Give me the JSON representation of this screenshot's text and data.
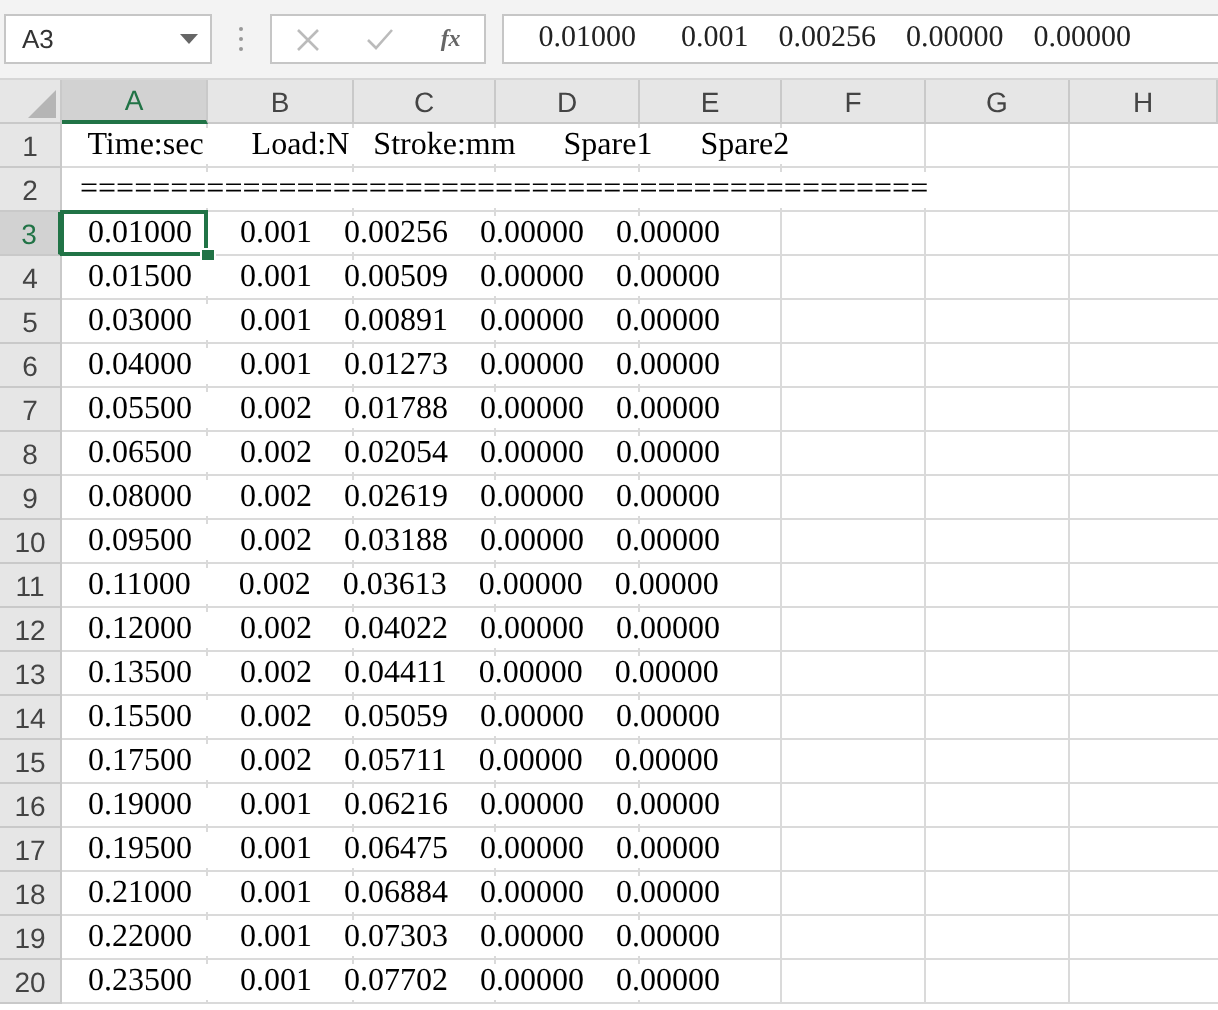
{
  "name_box": "A3",
  "formula_bar": {
    "fx_label": "fx",
    "value": "   0.01000      0.001    0.00256    0.00000    0.00000"
  },
  "columns": [
    {
      "label": "A",
      "selected": true
    },
    {
      "label": "B",
      "selected": false
    },
    {
      "label": "C",
      "selected": false
    },
    {
      "label": "D",
      "selected": false
    },
    {
      "label": "E",
      "selected": false
    },
    {
      "label": "F",
      "selected": false
    },
    {
      "label": "G",
      "selected": false
    },
    {
      "label": "H",
      "selected": false
    }
  ],
  "rows": [
    {
      "number": "1",
      "text": "   Time:sec      Load:N   Stroke:mm      Spare1      Spare2",
      "selected": false
    },
    {
      "number": "2",
      "text": "  ===============================================",
      "selected": false
    },
    {
      "number": "3",
      "text": "   0.01000      0.001    0.00256    0.00000    0.00000",
      "selected": true
    },
    {
      "number": "4",
      "text": "   0.01500      0.001    0.00509    0.00000    0.00000",
      "selected": false
    },
    {
      "number": "5",
      "text": "   0.03000      0.001    0.00891    0.00000    0.00000",
      "selected": false
    },
    {
      "number": "6",
      "text": "   0.04000      0.001    0.01273    0.00000    0.00000",
      "selected": false
    },
    {
      "number": "7",
      "text": "   0.05500      0.002    0.01788    0.00000    0.00000",
      "selected": false
    },
    {
      "number": "8",
      "text": "   0.06500      0.002    0.02054    0.00000    0.00000",
      "selected": false
    },
    {
      "number": "9",
      "text": "   0.08000      0.002    0.02619    0.00000    0.00000",
      "selected": false
    },
    {
      "number": "10",
      "text": "   0.09500      0.002    0.03188    0.00000    0.00000",
      "selected": false
    },
    {
      "number": "11",
      "text": "   0.11000      0.002    0.03613    0.00000    0.00000",
      "selected": false
    },
    {
      "number": "12",
      "text": "   0.12000      0.002    0.04022    0.00000    0.00000",
      "selected": false
    },
    {
      "number": "13",
      "text": "   0.13500      0.002    0.04411    0.00000    0.00000",
      "selected": false
    },
    {
      "number": "14",
      "text": "   0.15500      0.002    0.05059    0.00000    0.00000",
      "selected": false
    },
    {
      "number": "15",
      "text": "   0.17500      0.002    0.05711    0.00000    0.00000",
      "selected": false
    },
    {
      "number": "16",
      "text": "   0.19000      0.001    0.06216    0.00000    0.00000",
      "selected": false
    },
    {
      "number": "17",
      "text": "   0.19500      0.001    0.06475    0.00000    0.00000",
      "selected": false
    },
    {
      "number": "18",
      "text": "   0.21000      0.001    0.06884    0.00000    0.00000",
      "selected": false
    },
    {
      "number": "19",
      "text": "   0.22000      0.001    0.07303    0.00000    0.00000",
      "selected": false
    },
    {
      "number": "20",
      "text": "   0.23500      0.001    0.07702    0.00000    0.00000",
      "selected": false
    }
  ]
}
